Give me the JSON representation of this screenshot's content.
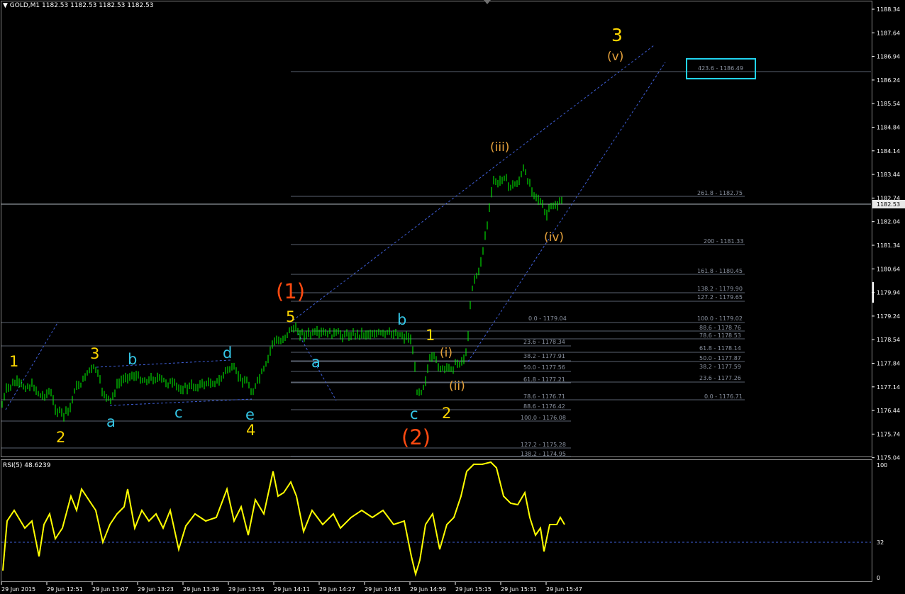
{
  "header": {
    "symbol": "GOLD,M1",
    "ohlc": "1182.53 1182.53 1182.53 1182.53"
  },
  "rsi": {
    "label": "RSI(5) 48.6239",
    "levels": [
      "100",
      "32",
      "0"
    ]
  },
  "price_axis": {
    "ticks": [
      "1188.34",
      "1187.64",
      "1186.94",
      "1186.24",
      "1185.54",
      "1184.84",
      "1184.14",
      "1183.44",
      "1182.74",
      "1182.04",
      "1181.34",
      "1180.64",
      "1179.94",
      "1179.24",
      "1178.54",
      "1177.84",
      "1177.14",
      "1176.44",
      "1175.74",
      "1175.04"
    ],
    "current": "1182.53"
  },
  "time_axis": [
    "29 Jun 2015",
    "29 Jun 12:51",
    "29 Jun 13:07",
    "29 Jun 13:23",
    "29 Jun 13:39",
    "29 Jun 13:55",
    "29 Jun 14:11",
    "29 Jun 14:27",
    "29 Jun 14:43",
    "29 Jun 14:59",
    "29 Jun 15:15",
    "29 Jun 15:31",
    "29 Jun 15:47"
  ],
  "fib_labels": {
    "target": "423.6 - 1186.49",
    "ext_top": [
      "261.8 - 1182.75",
      "200 - 1181.33",
      "161.8 - 1180.45",
      "138.2 - 1179.90",
      "127.2 - 1179.65"
    ],
    "retr_a": [
      "0.0 - 1179.04",
      "23.6 - 1178.34",
      "38.2 - 1177.91",
      "50.0 - 1177.56",
      "61.8 - 1177.21",
      "78.6 - 1176.71",
      "88.6 - 1176.42",
      "100.0 - 1176.08",
      "127.2 - 1175.28",
      "138.2 - 1174.95"
    ],
    "retr_b": [
      "100.0 - 1179.02",
      "88.6 - 1178.76",
      "78.6 - 1178.53",
      "61.8 - 1178.14",
      "50.0 - 1177.87",
      "38.2 - 1177.59",
      "23.6 - 1177.26",
      "0.0 - 1176.71"
    ]
  },
  "wave_labels": {
    "w1": "1",
    "w2": "2",
    "w3": "3",
    "w4": "4",
    "w5": "5",
    "a1": "a",
    "b1": "b",
    "c1": "c",
    "d1": "d",
    "e1": "e",
    "big1": "(1)",
    "big2": "(2)",
    "a2": "a",
    "b2": "b",
    "c2": "c",
    "s1": "1",
    "s2": "2",
    "i": "(i)",
    "ii": "(ii)",
    "iii": "(iii)",
    "iv": "(iv)",
    "v": "(v)",
    "big3": "3"
  },
  "colors": {
    "bg": "#000000",
    "candle": "#00ff00",
    "rsi": "#ffff00",
    "yellow": "#ffd700",
    "cyan": "#34c6e6",
    "orange": "#e6a23c",
    "red": "#ff4000",
    "fib": "#606878",
    "channel": "#4060e0"
  }
}
